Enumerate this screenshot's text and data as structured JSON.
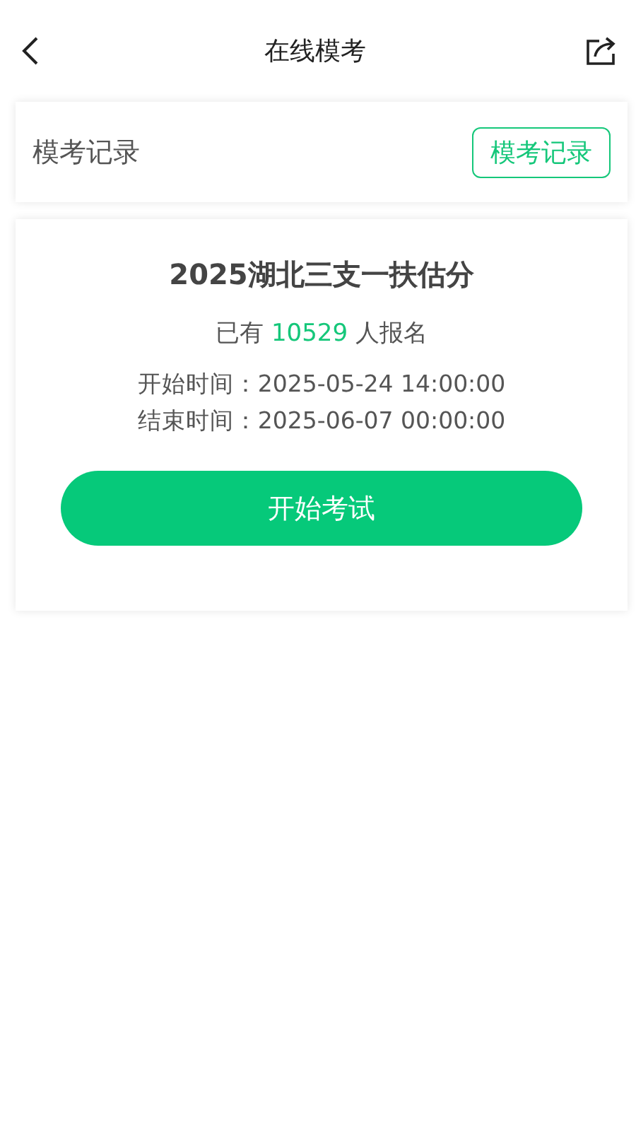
{
  "header": {
    "title": "在线模考"
  },
  "records_card": {
    "label": "模考记录",
    "button": "模考记录"
  },
  "exam_card": {
    "title": "2025湖北三支一扶估分",
    "registration": {
      "prefix": "已有",
      "count": "10529",
      "suffix": "人报名"
    },
    "times": [
      "开始时间：2025-05-24 14:00:00",
      "结束时间：2025-06-07 00:00:00"
    ],
    "start_button": "开始考试"
  }
}
